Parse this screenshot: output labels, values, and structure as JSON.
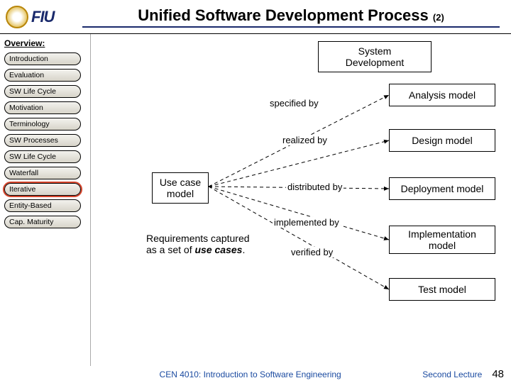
{
  "header": {
    "logo_text": "FIU",
    "title": "Unified Software Development Process",
    "title_suffix": "(2)"
  },
  "sidebar": {
    "heading": "Overview:",
    "items": [
      {
        "label": "Introduction",
        "active": false
      },
      {
        "label": "Evaluation",
        "active": false
      },
      {
        "label": "SW Life Cycle",
        "active": false
      },
      {
        "label": "Motivation",
        "active": false
      },
      {
        "label": "Terminology",
        "active": false
      },
      {
        "label": "SW Processes",
        "active": false
      },
      {
        "label": "SW Life Cycle",
        "active": false
      },
      {
        "label": "Waterfall",
        "active": false
      },
      {
        "label": "Iterative",
        "active": true
      },
      {
        "label": "Entity-Based",
        "active": false
      },
      {
        "label": "Cap. Maturity",
        "active": false
      }
    ]
  },
  "diagram": {
    "top_box": "System\nDevelopment",
    "source_box": "Use case model",
    "source_caption": "Requirements captured as a set of use cases.",
    "edges": [
      {
        "label": "specified by",
        "target": "Analysis model"
      },
      {
        "label": "realized by",
        "target": "Design model"
      },
      {
        "label": "distributed by",
        "target": "Deployment model"
      },
      {
        "label": "implemented by",
        "target": "Implementation model"
      },
      {
        "label": "verified by",
        "target": "Test model"
      }
    ]
  },
  "footer": {
    "course": "CEN 4010: Introduction to Software Engineering",
    "lecture": "Second Lecture",
    "page": "48"
  }
}
